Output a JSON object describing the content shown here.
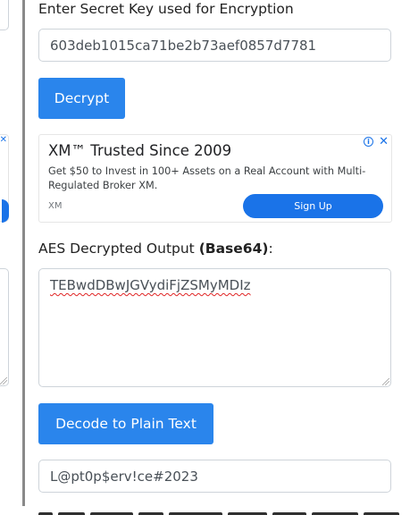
{
  "key_section": {
    "label": "Enter Secret Key used for Encryption",
    "value": "603deb1015ca71be2b73aef0857d7781"
  },
  "decrypt_button": {
    "label": "Decrypt"
  },
  "ad": {
    "headline": "XM™ Trusted Since 2009",
    "description": "Get $50 to Invest in 100+ Assets on a Real Account with Multi-Regulated Broker XM.",
    "brand": "XM",
    "cta": "Sign Up",
    "adchoices_icon": "info-icon",
    "close_icon": "close-icon"
  },
  "output_section": {
    "label": "AES Decrypted Output ",
    "label_bold": "(Base64)",
    "label_suffix": ":",
    "value": "TEBwdDBwJGVydiFjZSMyMDIz"
  },
  "decode_button": {
    "label": "Decode to Plain Text"
  },
  "plain_text_output": {
    "value": "L@pt0p$erv!ce#2023"
  },
  "colors": {
    "primary_button": "#2a85ec",
    "ad_blue": "#1a73e8",
    "border": "#ced4da"
  }
}
